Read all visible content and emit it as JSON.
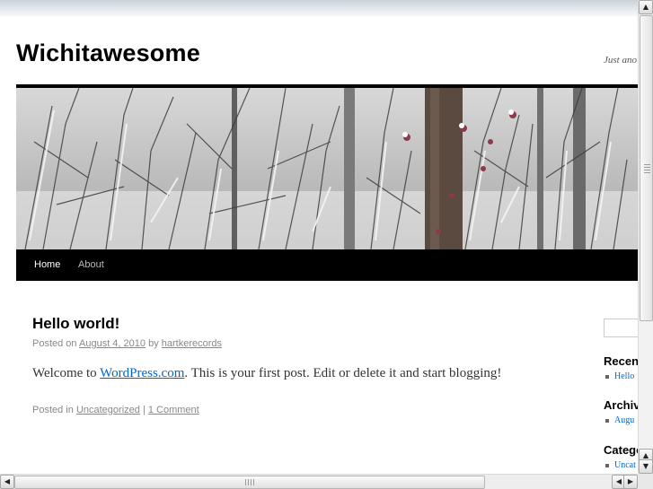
{
  "site": {
    "title": "Wichitawesome",
    "description": "Just ano"
  },
  "nav": {
    "items": [
      {
        "label": "Home"
      },
      {
        "label": "About"
      }
    ]
  },
  "post": {
    "title": "Hello world!",
    "meta": {
      "posted_on": "Posted on",
      "date": "August 4, 2010",
      "by": "by",
      "author": "hartkerecords"
    },
    "content": {
      "prefix": "Welcome to ",
      "link": "WordPress.com",
      "suffix": ". This is your first post. Edit or delete it and start blogging!"
    },
    "utility": {
      "posted_in": "Posted in",
      "category": "Uncategorized",
      "separator": "|",
      "comments": "1 Comment"
    }
  },
  "sidebar": {
    "widgets": [
      {
        "title": "Recen",
        "item": "Hello"
      },
      {
        "title": "Archiv",
        "item": "Augu"
      },
      {
        "title": "Catego",
        "item": "Uncat"
      }
    ]
  },
  "scrollbars": {
    "up_arrow": "▲",
    "down_arrow": "▼",
    "left_arrow": "◀",
    "right_arrow": "▶"
  },
  "colors": {
    "link": "#0066cc",
    "nav_bg": "#000000",
    "meta_text": "#888888"
  }
}
